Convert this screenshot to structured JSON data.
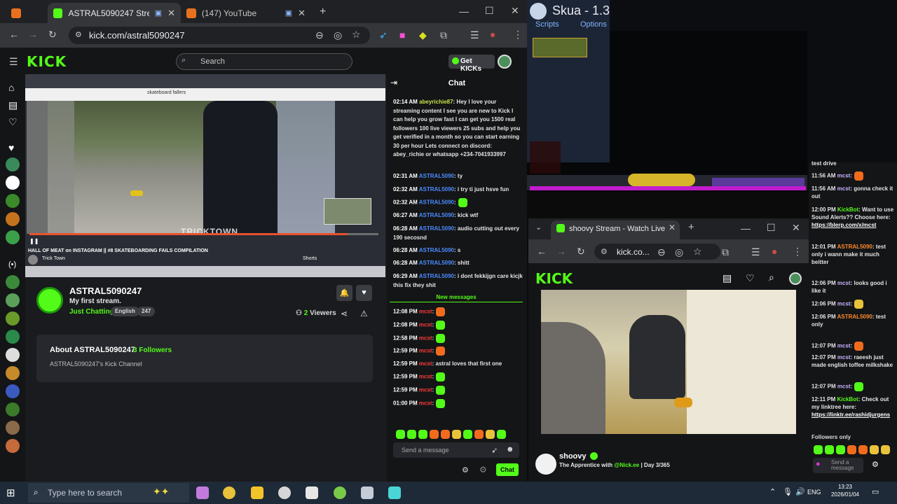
{
  "browser1": {
    "tabs": [
      {
        "title": ""
      },
      {
        "title": "ASTRAL5090247 Stream - \\"
      },
      {
        "title": "(147) YouTube"
      }
    ],
    "url": "kick.com/astral5090247"
  },
  "kick": {
    "search_placeholder": "Search",
    "get_kicks": "Get KICKs",
    "channel": {
      "name": "ASTRAL5090247",
      "title": "My first stream.",
      "category": "Just Chatting",
      "tags": [
        "English",
        "247"
      ],
      "viewers_count": "2",
      "viewers_label": "Viewers",
      "about_title": "About ASTRAL5090247",
      "followers": "3 Followers",
      "description": "ASTRAL5090247's Kick Channel"
    },
    "video": {
      "overlay_text": "HALL OF MEAT on INSTAGRAM || #8 SKATEBOARDING FAILS COMPILATION",
      "channel_name": "Trick Town",
      "search_text": "skateboard fallers",
      "watermark": "TRICKTOWN",
      "shorts": "Shorts"
    },
    "chat": {
      "header": "Chat",
      "messages": [
        {
          "time": "02:14 AM",
          "user": "abeyrichie87",
          "text": ": Hey I love your streaming content I see you are new to Kick I can help you grow fast I can get you 1500 real followers 100 live viewers 25 subs and help you get verified in a month so you can start earning 30 per hour Lets connect on discord: abey_richie or whatsapp +234-7041933997"
        },
        {
          "time": "02:31 AM",
          "user": "ASTRAL5090",
          "text": ": ty"
        },
        {
          "time": "02:32 AM",
          "user": "ASTRAL5090",
          "text": ": i try ti just hsve fun"
        },
        {
          "time": "02:32 AM",
          "user": "ASTRAL5090",
          "text": ":"
        },
        {
          "time": "06:27 AM",
          "user": "ASTRAL5090",
          "text": ": kick wtf"
        },
        {
          "time": "06:28 AM",
          "user": "ASTRAL5090",
          "text": ": audio cutting out every 190 secosnd"
        },
        {
          "time": "06:28 AM",
          "user": "ASTRAL5090",
          "text": ": s"
        },
        {
          "time": "06:28 AM",
          "user": "ASTRAL5090",
          "text": ": shitt"
        },
        {
          "time": "06:29 AM",
          "user": "ASTRAL5090",
          "text": ": i dont fekkijgn care kicjk this fix they shit"
        }
      ],
      "new_messages": "New messages",
      "new": [
        {
          "time": "12:08 PM",
          "user": "mcst",
          "text": ":"
        },
        {
          "time": "12:08 PM",
          "user": "mcst",
          "text": ":"
        },
        {
          "time": "12:58 PM",
          "user": "mcst",
          "text": ":"
        },
        {
          "time": "12:59 PM",
          "user": "mcst",
          "text": ":"
        },
        {
          "time": "12:59 PM",
          "user": "mcst",
          "text": ": astral loves that first one"
        },
        {
          "time": "12:59 PM",
          "user": "mcst",
          "text": ":"
        },
        {
          "time": "12:59 PM",
          "user": "mcst",
          "text": ":"
        },
        {
          "time": "01:00 PM",
          "user": "mcst",
          "text": ":"
        }
      ],
      "send_placeholder": "Send a message",
      "chat_button": "Chat"
    }
  },
  "skua": {
    "title": "Skua - 1.3",
    "menu": [
      "Scripts",
      "Options"
    ]
  },
  "browser2": {
    "tab_title": "shoovy Stream - Watch Live",
    "url": "kick.co...",
    "streamer": "shoovy",
    "stream_title_prefix": "The Apprentice with",
    "stream_title_mention": "@Nick.ee",
    "stream_title_suffix": "| Day 3/365"
  },
  "chat2": {
    "messages": [
      {
        "time": "",
        "user": "",
        "text": "test drive"
      },
      {
        "time": "11:56 AM",
        "user": "mcst",
        "text": ":"
      },
      {
        "time": "11:56 AM",
        "user": "mcst",
        "text": ": gonna check it out"
      },
      {
        "time": "12:00 PM",
        "user": "KickBot",
        "text": ": Want to use Sound Alerts?? Choose here:",
        "link": "https://blerp.com/x/mcst"
      },
      {
        "time": "12:01 PM",
        "user": "ASTRAL5090",
        "text": ": test only i wann make it much beitter"
      },
      {
        "time": "12:06 PM",
        "user": "mcst",
        "text": ": looks good i like it"
      },
      {
        "time": "12:06 PM",
        "user": "mcst",
        "text": ":"
      },
      {
        "time": "12:06 PM",
        "user": "ASTRAL5090",
        "text": ": test only"
      },
      {
        "time": "12:07 PM",
        "user": "mcst",
        "text": ":"
      },
      {
        "time": "12:07 PM",
        "user": "mcst",
        "text": ": raeesh just made english toffee milkshake"
      },
      {
        "time": "12:07 PM",
        "user": "mcst",
        "text": ":"
      },
      {
        "time": "12:11 PM",
        "user": "KickBot",
        "text": ": Check out my linktree here:",
        "link": "https://linktr.ee/rashidjurgens"
      }
    ],
    "followers_only": "Followers only",
    "send_placeholder": "Send a message"
  },
  "taskbar": {
    "search_placeholder": "Type here to search",
    "language": "ENG",
    "time": "13:23",
    "date": "2026/01/04"
  },
  "colors": {
    "kick_green": "#53fc18",
    "bg": "#141517"
  }
}
